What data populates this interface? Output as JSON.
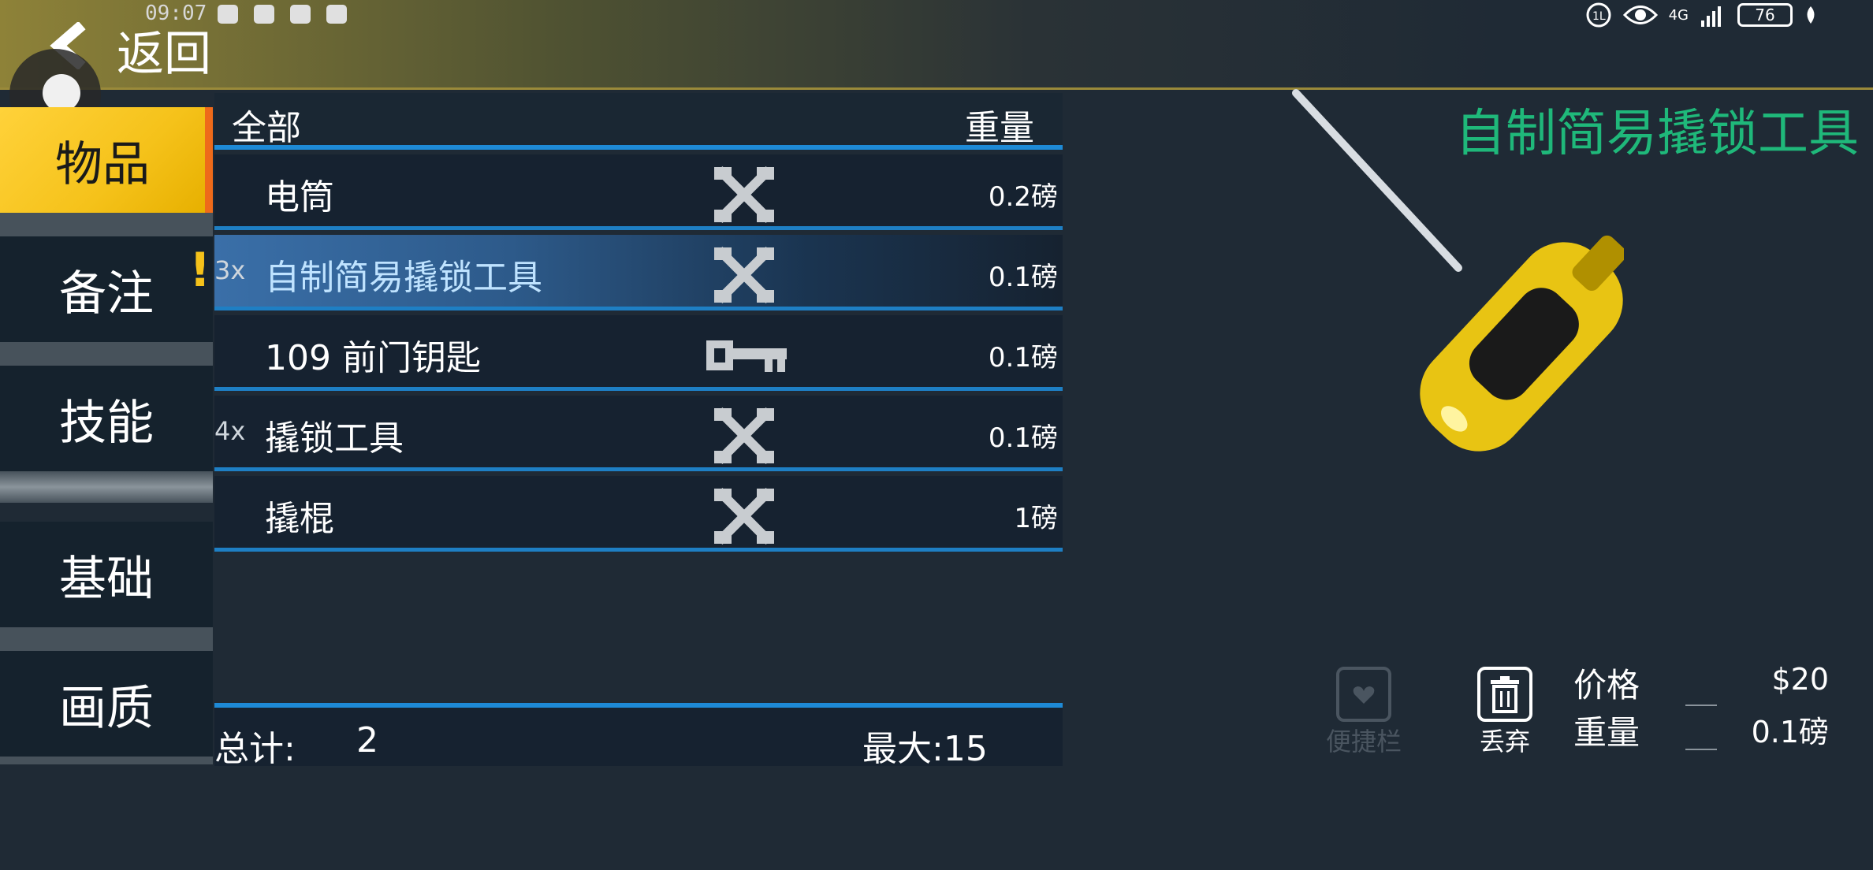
{
  "status_bar": {
    "time": "09:07",
    "battery": "76",
    "network": "4G"
  },
  "header": {
    "back_label": "返回"
  },
  "sidebar": {
    "items": [
      {
        "label": "物品",
        "active": true,
        "alert": false
      },
      {
        "label": "备注",
        "active": false,
        "alert": true
      },
      {
        "label": "技能",
        "active": false,
        "alert": false
      },
      {
        "label": "基础",
        "active": false,
        "alert": false
      },
      {
        "label": "画质",
        "active": false,
        "alert": false
      }
    ],
    "alert_mark": "!"
  },
  "inventory": {
    "filter_label": "全部",
    "weight_header": "重量",
    "rows": [
      {
        "qty": "",
        "name": "电筒",
        "icon": "tools-icon",
        "weight": "0.2磅",
        "selected": false
      },
      {
        "qty": "3x",
        "name": "自制简易撬锁工具",
        "icon": "tools-icon",
        "weight": "0.1磅",
        "selected": true
      },
      {
        "qty": "",
        "name": "109 前门钥匙",
        "icon": "key-icon",
        "weight": "0.1磅",
        "selected": false
      },
      {
        "qty": "4x",
        "name": "撬锁工具",
        "icon": "tools-icon",
        "weight": "0.1磅",
        "selected": false
      },
      {
        "qty": "",
        "name": "撬棍",
        "icon": "tools-icon",
        "weight": "1磅",
        "selected": false
      }
    ],
    "total_label": "总计:",
    "total_value": "2",
    "max_label": "最大:15"
  },
  "detail": {
    "title": "自制简易撬锁工具",
    "hotbar_label": "便捷栏",
    "discard_label": "丢弃",
    "price_label": "价格",
    "price_value": "$20",
    "weight_label": "重量",
    "weight_value": "0.1磅"
  },
  "colors": {
    "accent_blue": "#1e8ad6",
    "active_tab": "#f5c21a",
    "title_green": "#1fb87a"
  }
}
